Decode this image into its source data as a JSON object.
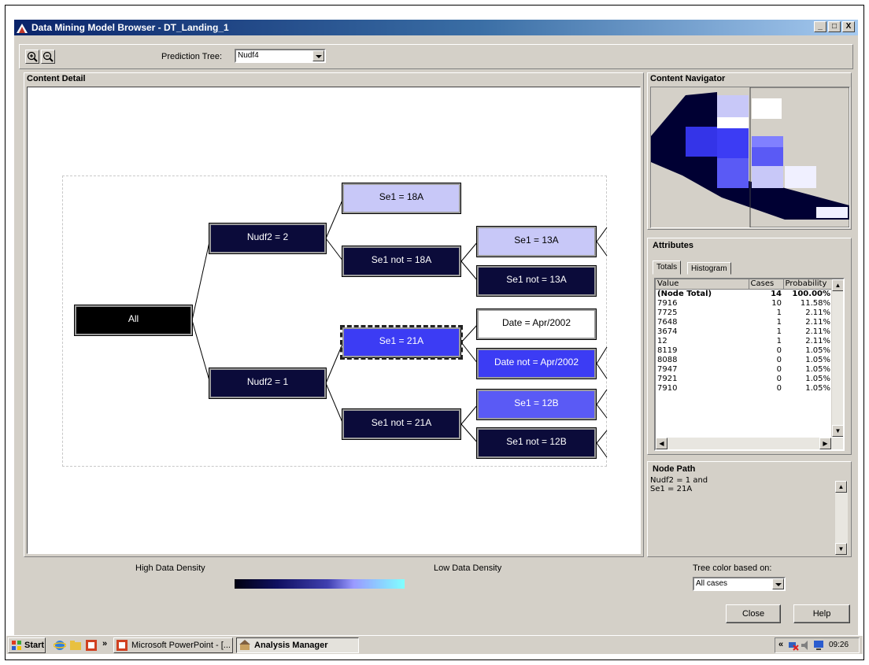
{
  "window": {
    "title": "Data Mining Model Browser - DT_Landing_1",
    "controls": [
      "_",
      "□",
      "X"
    ]
  },
  "toolbar": {
    "zoom_in_icon": "zoom-in-icon",
    "zoom_out_icon": "zoom-out-icon",
    "prediction_tree_label": "Prediction Tree:",
    "prediction_tree_value": "Nudf4"
  },
  "content_detail": {
    "title": "Content Detail",
    "nodes": {
      "all": "All",
      "nudf2_2": "Nudf2 = 2",
      "nudf2_1": "Nudf2 = 1",
      "se1_18a": "Se1 = 18A",
      "se1_not_18a": "Se1 not = 18A",
      "se1_21a": "Se1 = 21A",
      "se1_not_21a": "Se1 not = 21A",
      "se1_13a": "Se1 = 13A",
      "se1_not_13a": "Se1 not = 13A",
      "date_apr2002": "Date = Apr/2002",
      "date_not_apr2002": "Date not = Apr/2002",
      "se1_12b": "Se1 = 12B",
      "se1_not_12b": "Se1 not = 12B"
    }
  },
  "navigator": {
    "title": "Content Navigator"
  },
  "attributes": {
    "title": "Attributes",
    "tabs": [
      "Totals",
      "Histogram"
    ],
    "columns": [
      "Value",
      "Cases",
      "Probability"
    ],
    "rows": [
      [
        "(Node Total)",
        "14",
        "100.00%"
      ],
      [
        "7916",
        "10",
        "11.58%"
      ],
      [
        "7725",
        "1",
        "2.11%"
      ],
      [
        "7648",
        "1",
        "2.11%"
      ],
      [
        "3674",
        "1",
        "2.11%"
      ],
      [
        "12",
        "1",
        "2.11%"
      ],
      [
        "8119",
        "0",
        "1.05%"
      ],
      [
        "8088",
        "0",
        "1.05%"
      ],
      [
        "7947",
        "0",
        "1.05%"
      ],
      [
        "7921",
        "0",
        "1.05%"
      ],
      [
        "7910",
        "0",
        "1.05%"
      ]
    ]
  },
  "node_path": {
    "title": "Node Path",
    "line1": "Nudf2 = 1  and",
    "line2": "Se1 = 21A"
  },
  "legend": {
    "high": "High Data Density",
    "low": "Low Data Density"
  },
  "tree_color": {
    "label": "Tree color based on:",
    "value": "All cases"
  },
  "buttons": {
    "close": "Close",
    "help": "Help"
  },
  "taskbar": {
    "start": "Start",
    "overflow": "»",
    "tasks": [
      "Microsoft PowerPoint - [...",
      "Analysis Manager"
    ],
    "tray_overflow": "«",
    "clock": "09:26"
  }
}
